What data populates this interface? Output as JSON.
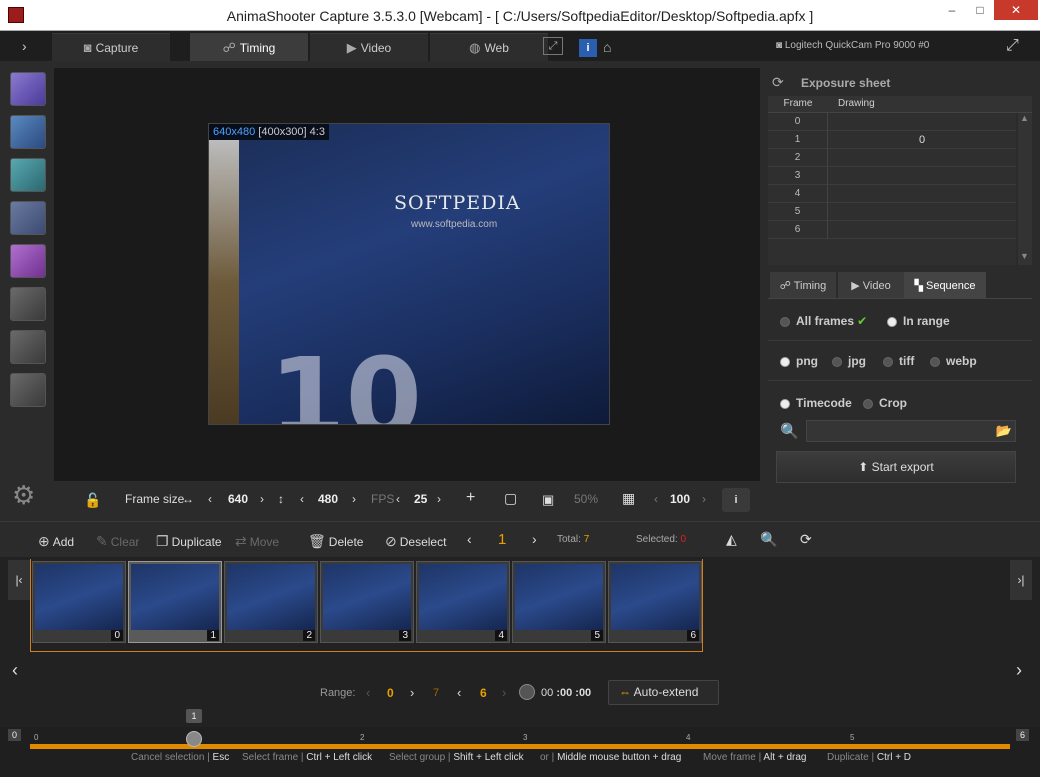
{
  "window": {
    "title": "AnimaShooter Capture 3.5.3.0 [Webcam]  - [ C:/Users/SoftpediaEditor/Desktop/Softpedia.apfx ]",
    "minimize": "–",
    "maximize": "□",
    "close": "✕"
  },
  "tabs": [
    {
      "label": "Capture",
      "icon": "camera-icon"
    },
    {
      "label": "Timing",
      "icon": "running-man-icon"
    },
    {
      "label": "Video",
      "icon": "film-icon"
    },
    {
      "label": "Web",
      "icon": "globe-icon"
    }
  ],
  "camera": {
    "name": "Logitech QuickCam Pro 9000 #0"
  },
  "preview": {
    "resolution": "640x480",
    "size": "[400x300]",
    "ratio": "4:3",
    "logo": "SOFTPEDIA",
    "url": "www.softpedia.com"
  },
  "frame_controls": {
    "frame_size_label": "Frame size",
    "width": "640",
    "height": "480",
    "fps_label": "FPS",
    "fps": "25",
    "opacity": "50%",
    "grid_value": "100"
  },
  "exposure": {
    "title": "Exposure sheet",
    "col_frame": "Frame",
    "col_drawing": "Drawing",
    "rows": [
      {
        "frame": "0",
        "drawing": ""
      },
      {
        "frame": "1",
        "drawing": "0"
      },
      {
        "frame": "2",
        "drawing": ""
      },
      {
        "frame": "3",
        "drawing": ""
      },
      {
        "frame": "4",
        "drawing": ""
      },
      {
        "frame": "5",
        "drawing": ""
      },
      {
        "frame": "6",
        "drawing": ""
      }
    ]
  },
  "export_tabs": {
    "timing": "Timing",
    "video": "Video",
    "sequence": "Sequence"
  },
  "export": {
    "all_frames": "All frames",
    "in_range": "In range",
    "png": "png",
    "jpg": "jpg",
    "tiff": "tiff",
    "webp": "webp",
    "timecode": "Timecode",
    "crop": "Crop",
    "start": "Start export"
  },
  "toolbar": {
    "add": "Add",
    "clear": "Clear",
    "duplicate": "Duplicate",
    "move": "Move",
    "delete": "Delete",
    "deselect": "Deselect",
    "current": "1",
    "total_label": "Total:",
    "total": "7",
    "selected_label": "Selected:",
    "selected": "0"
  },
  "thumbs": [
    "0",
    "1",
    "2",
    "3",
    "4",
    "5",
    "6"
  ],
  "range": {
    "label": "Range:",
    "start": "0",
    "mid": "7",
    "end": "6",
    "t1": "00",
    "t2": ":00",
    "t3": ":00",
    "auto_extend": "Auto-extend"
  },
  "timeline": {
    "marker": "1",
    "ticks": [
      "0",
      "1",
      "2",
      "3",
      "4",
      "5",
      "6"
    ]
  },
  "hints": [
    {
      "label": "Cancel selection",
      "key": "Esc"
    },
    {
      "label": "Select frame",
      "key": "Ctrl + Left click"
    },
    {
      "label": "Select group",
      "key": "Shift + Left click"
    },
    {
      "label": "or",
      "key": "Middle mouse button + drag"
    },
    {
      "label": "Move frame",
      "key": "Alt + drag"
    },
    {
      "label": "Duplicate",
      "key": "Ctrl + D"
    }
  ]
}
